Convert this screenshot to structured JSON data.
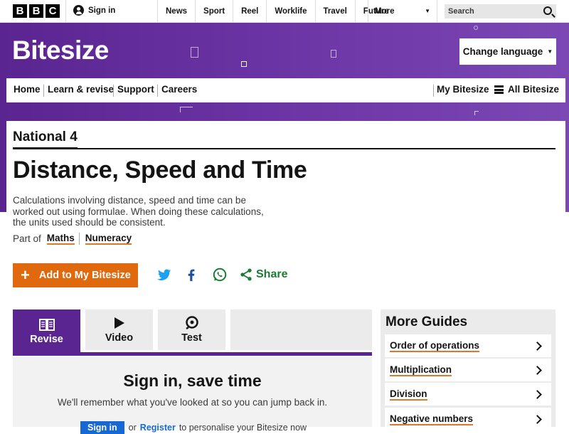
{
  "bbc_bar": {
    "logo_letters": [
      "B",
      "B",
      "C"
    ],
    "sign_in": "Sign in",
    "nav": [
      "News",
      "Sport",
      "Reel",
      "Worklife",
      "Travel",
      "Future"
    ],
    "more_label": "More",
    "search_placeholder": "Search"
  },
  "masthead": {
    "brand": "Bitesize",
    "change_language": "Change language",
    "subnav_left": [
      "Home",
      "Learn & revise",
      "Support",
      "Careers"
    ],
    "my_bitesize": "My Bitesize",
    "all_bitesize": "All Bitesize",
    "brand_color": "#5a2590"
  },
  "guide_page": {
    "level": "National 4",
    "title": "Distance, Speed and Time",
    "description": "Calculations involving distance, speed and time can be worked out using formulae. When doing these calculations, the units used should be consistent.",
    "part_of_label": "Part of",
    "part_of_links": [
      "Maths",
      "Numeracy"
    ],
    "add_button": "Add to My Bitesize",
    "add_button_color": "#e1690d",
    "share_label": "Share",
    "share_icons": [
      "twitter-icon",
      "facebook-icon",
      "whatsapp-icon",
      "share-icon"
    ]
  },
  "tabs": [
    {
      "label": "Revise",
      "icon": "book-icon",
      "active": true
    },
    {
      "label": "Video",
      "icon": "play-icon",
      "active": false
    },
    {
      "label": "Test",
      "icon": "quiz-icon",
      "active": false
    }
  ],
  "revise_panel": {
    "heading": "Sign in, save time",
    "text": "We'll remember what you've looked at so you can jump back in.",
    "signin_button": "Sign in",
    "or": "or",
    "register_link": "Register",
    "tail": "to personalise your Bitesize now"
  },
  "more_guides": {
    "heading": "More Guides",
    "items": [
      "Order of operations",
      "Multiplication",
      "Division",
      "Negative numbers"
    ]
  }
}
